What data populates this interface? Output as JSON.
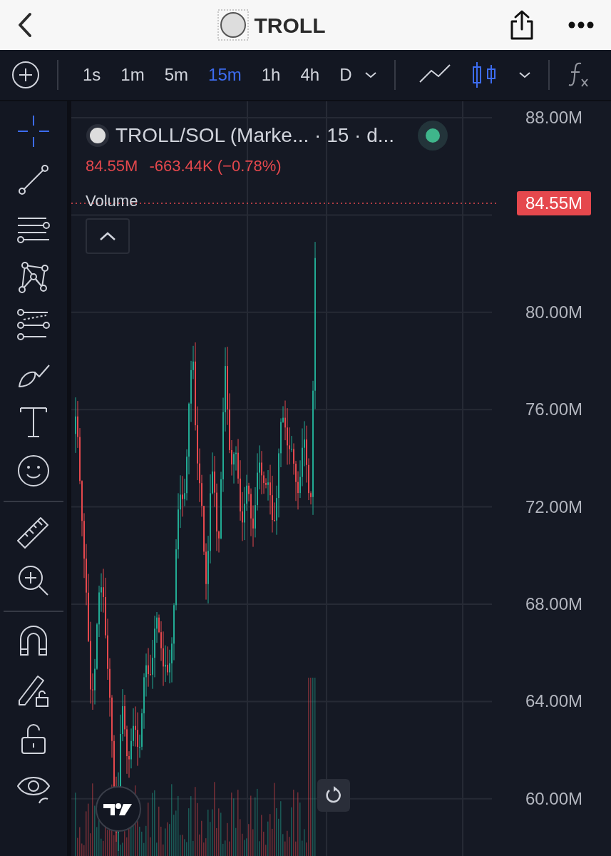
{
  "header": {
    "title": "TROLL"
  },
  "toolbar": {
    "intervals": [
      {
        "label": "1s",
        "selected": false
      },
      {
        "label": "1m",
        "selected": false
      },
      {
        "label": "5m",
        "selected": false
      },
      {
        "label": "15m",
        "selected": true
      },
      {
        "label": "1h",
        "selected": false
      },
      {
        "label": "4h",
        "selected": false
      },
      {
        "label": "D",
        "selected": false
      }
    ],
    "chart_types": [
      {
        "kind": "line",
        "selected": false
      },
      {
        "kind": "candles",
        "selected": true
      }
    ]
  },
  "tool_groups": [
    {
      "tools": [
        {
          "kind": "crosshair",
          "selected": true
        },
        {
          "kind": "trend-line",
          "selected": false
        },
        {
          "kind": "parallel-lines",
          "selected": false
        },
        {
          "kind": "pattern",
          "selected": false
        },
        {
          "kind": "fib",
          "selected": false
        },
        {
          "kind": "brush",
          "selected": false
        },
        {
          "kind": "text",
          "selected": false
        },
        {
          "kind": "smiley",
          "selected": false
        }
      ]
    },
    {
      "tools": [
        {
          "kind": "ruler",
          "selected": false
        },
        {
          "kind": "zoom",
          "selected": false
        }
      ]
    },
    {
      "tools": [
        {
          "kind": "magnet",
          "selected": false
        },
        {
          "kind": "lock-drawing",
          "selected": false
        },
        {
          "kind": "unlock",
          "selected": false
        },
        {
          "kind": "eye",
          "selected": false
        }
      ]
    }
  ],
  "legend": {
    "symbol": "TROLL/SOL (Marke... · 15 · d...",
    "market_open": true,
    "last": "84.55M",
    "change": "-663.44K (−0.78%)",
    "study": "Volume"
  },
  "price_axis": {
    "labels": [
      "88.00M",
      "80.00M",
      "76.00M",
      "72.00M",
      "68.00M",
      "64.00M",
      "60.00M"
    ],
    "current": "84.55M"
  }
}
